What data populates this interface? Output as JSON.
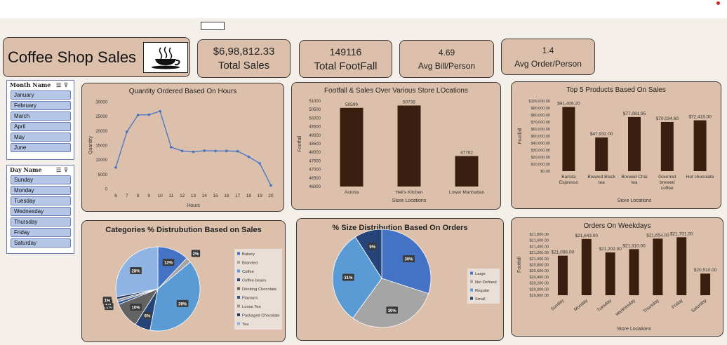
{
  "title": "Coffee Shop Sales",
  "kpis": {
    "total_sales_value": "$6,98,812.33",
    "total_sales_label": "Total Sales",
    "footfall_value": "149116",
    "footfall_label": "Total FootFall",
    "avg_bill_value": "4.69",
    "avg_bill_label": "Avg Bill/Person",
    "avg_order_value": "1.4",
    "avg_order_label": "Avg Order/Person"
  },
  "slicers": {
    "month": {
      "header": "Month Name",
      "items": [
        "January",
        "February",
        "March",
        "April",
        "May",
        "June"
      ]
    },
    "day": {
      "header": "Day Name",
      "items": [
        "Sunday",
        "Monday",
        "Tuesday",
        "Wednesday",
        "Thursday",
        "Friday",
        "Saturday"
      ]
    }
  },
  "colors": {
    "bar": "#3a1f10",
    "line": "#4472c4",
    "card": "#dcc0ab"
  },
  "chart_data": [
    {
      "id": "hours",
      "type": "line",
      "title": "Quantity Ordered Based On Hours",
      "xlabel": "Hours",
      "ylabel": "Quantity",
      "x": [
        6,
        7,
        8,
        9,
        10,
        11,
        12,
        13,
        14,
        15,
        16,
        17,
        18,
        19,
        20
      ],
      "values": [
        7300,
        19600,
        25400,
        25500,
        26700,
        14300,
        13000,
        12700,
        13100,
        13000,
        13000,
        12900,
        11000,
        8700,
        1100
      ],
      "ylim": [
        0,
        30000
      ],
      "yticks": [
        "0",
        "5000",
        "10000",
        "15000",
        "20000",
        "25000",
        "30000"
      ]
    },
    {
      "id": "stores",
      "type": "bar",
      "title": "Footfall & Sales Over Various Store LOcations",
      "xlabel": "Store Locations",
      "ylabel": "Footfall",
      "categories": [
        "Astoria",
        "Hell's Kitchen",
        "Lower Manhattan"
      ],
      "values": [
        50599,
        50735,
        47782
      ],
      "labels": [
        "50599",
        "50735",
        "47782"
      ],
      "ylim": [
        46000,
        51000
      ],
      "yticks": [
        "46000",
        "46500",
        "47000",
        "47500",
        "48000",
        "48500",
        "49000",
        "49500",
        "50000",
        "50500",
        "51000"
      ]
    },
    {
      "id": "products",
      "type": "bar",
      "title": "Top 5 Products Based On Sales",
      "xlabel": "Store Locations",
      "ylabel": "Footfall",
      "categories": [
        [
          "Barista",
          "Espresso"
        ],
        [
          "Brewed Black",
          "tea"
        ],
        [
          "Brewed Chai",
          "tea"
        ],
        [
          "Gourmet",
          "brewed",
          "coffee"
        ],
        [
          "Hot chocolate"
        ]
      ],
      "values": [
        91406.2,
        47932,
        77081.95,
        70034.6,
        72416
      ],
      "labels": [
        "$91,406.20",
        "$47,932.00",
        "$77,081.95",
        "$70,034.60",
        "$72,416.00"
      ],
      "ylim": [
        0,
        100000
      ],
      "yticks": [
        "$0.00",
        "$10,000.00",
        "$20,000.00",
        "$30,000.00",
        "$40,000.00",
        "$50,000.00",
        "$60,000.00",
        "$70,000.00",
        "$80,000.00",
        "$90,000.00",
        "$100,000.00"
      ]
    },
    {
      "id": "categories",
      "type": "pie",
      "title": "Categories % Distrubution Based on Sales",
      "legend": [
        "Bakery",
        "Branded",
        "Coffee",
        "Coffee beans",
        "Drinking Chocolate",
        "Flavours",
        "Loose Tea",
        "Packaged Chocolate",
        "Tea"
      ],
      "values": [
        12,
        2,
        39,
        6,
        10,
        1,
        1,
        1,
        28
      ],
      "labels": [
        "12%",
        "2%",
        "39%",
        "6%",
        "10%",
        "1%",
        "1%",
        "1%",
        "28%"
      ],
      "colors": [
        "#4472c4",
        "#a5a5a5",
        "#5b9bd5",
        "#264478",
        "#636363",
        "#2e5597",
        "#999999",
        "#1f3864",
        "#8fb4e3"
      ]
    },
    {
      "id": "sizes",
      "type": "pie",
      "title": "% Size Distribution Based On Orders",
      "legend": [
        "Large",
        "Not Defined",
        "Regular",
        "Small"
      ],
      "values": [
        30,
        30,
        31,
        9
      ],
      "labels": [
        "30%",
        "30%",
        "31%",
        "9%"
      ],
      "colors": [
        "#4472c4",
        "#a5a5a5",
        "#5b9bd5",
        "#264478"
      ]
    },
    {
      "id": "weekdays",
      "type": "bar",
      "title": "Orders On Weekdays",
      "xlabel": "Store Locations",
      "ylabel": "Footfall",
      "categories": [
        "Sunday",
        "Monday",
        "Tuesday",
        "Wednesday",
        "Thursday",
        "Friday",
        "Saturday"
      ],
      "values": [
        21096,
        21643,
        21202,
        21310,
        21654,
        21701,
        20510
      ],
      "labels": [
        "$21,096.00",
        "$21,643.00",
        "$21,202.00",
        "$21,310.00",
        "$21,654.00",
        "$21,701.00",
        "$20,510.00"
      ],
      "ylim": [
        19800,
        21800
      ],
      "yticks": [
        "$19,800.00",
        "$20,000.00",
        "$20,200.00",
        "$20,400.00",
        "$20,600.00",
        "$20,800.00",
        "$21,000.00",
        "$21,200.00",
        "$21,400.00",
        "$21,600.00",
        "$21,800.00"
      ]
    }
  ]
}
